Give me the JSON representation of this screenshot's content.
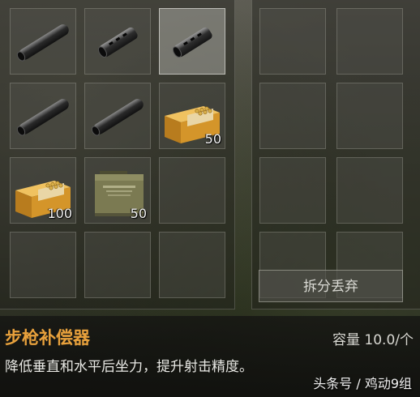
{
  "inventory": {
    "left_slots": [
      {
        "item": "compensator-long",
        "count": ""
      },
      {
        "item": "compensator-short",
        "count": ""
      },
      {
        "item": "compensator-short",
        "count": "",
        "selected": true
      },
      {
        "item": "compensator-long",
        "count": ""
      },
      {
        "item": "compensator-long",
        "count": ""
      },
      {
        "item": "ammo-box-orange",
        "count": "50"
      },
      {
        "item": "ammo-box-orange",
        "count": "100"
      },
      {
        "item": "ammo-can-olive",
        "count": "50"
      },
      {
        "item": "empty",
        "count": ""
      },
      {
        "item": "empty",
        "count": ""
      },
      {
        "item": "empty",
        "count": ""
      },
      {
        "item": "empty",
        "count": ""
      }
    ],
    "right_slots_count": 8
  },
  "actions": {
    "split_discard": "拆分丢弃"
  },
  "item_info": {
    "name": "步枪补偿器",
    "capacity": "容量 10.0/个",
    "description": "降低垂直和水平后坐力，提升射击精度。"
  },
  "watermark": "头条号 / 鸡动9组",
  "colors": {
    "item_name": "#e8a13c",
    "ammo_orange": "#d4952a",
    "ammo_can_olive": "#6f6e4a"
  }
}
